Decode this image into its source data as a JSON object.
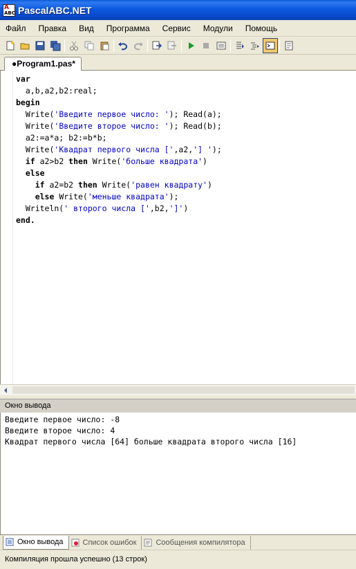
{
  "window": {
    "title": "PascalABC.NET",
    "icon": "pascalabc-app-icon"
  },
  "menu": [
    "Файл",
    "Правка",
    "Вид",
    "Программа",
    "Сервис",
    "Модули",
    "Помощь"
  ],
  "toolbar": {
    "icons": [
      "new-file-icon",
      "open-folder-icon",
      "save-icon",
      "save-all-icon",
      "cut-icon",
      "copy-icon",
      "paste-icon",
      "undo-icon",
      "redo-icon",
      "find-icon",
      "replace-icon",
      "run-icon",
      "stop-icon",
      "compile-icon",
      "debug-step-icon",
      "format-code-icon",
      "output-window-icon",
      "properties-icon"
    ],
    "active": "output-window-icon"
  },
  "editor_tab": {
    "label": "●Program1.pas*"
  },
  "code": [
    [
      {
        "t": "var",
        "c": "kw"
      }
    ],
    [
      {
        "t": "  a,b,a2,b2:real;",
        "c": "fn"
      }
    ],
    [
      {
        "t": "begin",
        "c": "kw"
      }
    ],
    [
      {
        "t": "  Write(",
        "c": "fn"
      },
      {
        "t": "'Введите первое число: '",
        "c": "str"
      },
      {
        "t": "); Read(a);",
        "c": "fn"
      }
    ],
    [
      {
        "t": "  Write(",
        "c": "fn"
      },
      {
        "t": "'Введите второе число: '",
        "c": "str"
      },
      {
        "t": "); Read(b);",
        "c": "fn"
      }
    ],
    [
      {
        "t": "  a2:=a*a; b2:=b*b;",
        "c": "fn"
      }
    ],
    [
      {
        "t": "  Write(",
        "c": "fn"
      },
      {
        "t": "'Квадрат первого числа ['",
        "c": "str"
      },
      {
        "t": ",a2,",
        "c": "fn"
      },
      {
        "t": "'] '",
        "c": "str"
      },
      {
        "t": ");",
        "c": "fn"
      }
    ],
    [
      {
        "t": "  if",
        "c": "kw"
      },
      {
        "t": " a2>b2 ",
        "c": "fn"
      },
      {
        "t": "then",
        "c": "kw"
      },
      {
        "t": " Write(",
        "c": "fn"
      },
      {
        "t": "'больше квадрата'",
        "c": "str"
      },
      {
        "t": ")",
        "c": "fn"
      }
    ],
    [
      {
        "t": "  else",
        "c": "kw"
      }
    ],
    [
      {
        "t": "    if",
        "c": "kw"
      },
      {
        "t": " a2=b2 ",
        "c": "fn"
      },
      {
        "t": "then",
        "c": "kw"
      },
      {
        "t": " Write(",
        "c": "fn"
      },
      {
        "t": "'равен квадрату'",
        "c": "str"
      },
      {
        "t": ")",
        "c": "fn"
      }
    ],
    [
      {
        "t": "    else",
        "c": "kw"
      },
      {
        "t": " Write(",
        "c": "fn"
      },
      {
        "t": "'меньше квадрата'",
        "c": "str"
      },
      {
        "t": ");",
        "c": "fn"
      }
    ],
    [
      {
        "t": "  Writeln(",
        "c": "fn"
      },
      {
        "t": "' второго числа ['",
        "c": "str"
      },
      {
        "t": ",b2,",
        "c": "fn"
      },
      {
        "t": "']'",
        "c": "str"
      },
      {
        "t": ")",
        "c": "fn"
      }
    ],
    [
      {
        "t": "end.",
        "c": "kw"
      }
    ]
  ],
  "output": {
    "header": "Окно вывода",
    "lines": [
      "Введите первое число: -8",
      "Введите второе число: 4",
      "Квадрат первого числа [64] больше квадрата второго числа [16]"
    ]
  },
  "bottom_tabs": [
    {
      "label": "Окно вывода",
      "icon": "output-icon",
      "active": true
    },
    {
      "label": "Список ошибок",
      "icon": "error-list-icon",
      "active": false
    },
    {
      "label": "Сообщения компилятора",
      "icon": "compiler-messages-icon",
      "active": false
    }
  ],
  "status": {
    "text": "Компиляция прошла успешно (13 строк)"
  },
  "colors": {
    "titlebar": "#0c59e0",
    "string": "#0000c0",
    "chrome": "#ece9d8",
    "active_toolbar": "#f0c870"
  }
}
